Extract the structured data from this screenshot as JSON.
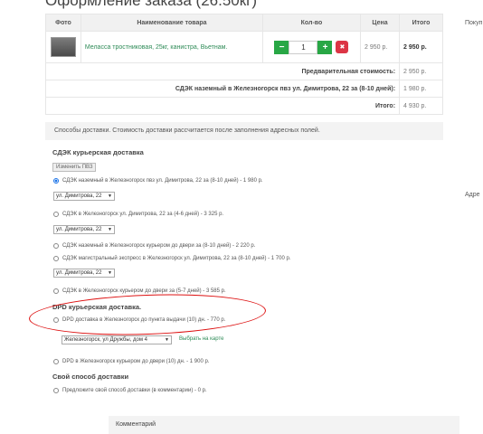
{
  "title": "Оформление заказа (26.50кг)",
  "right": {
    "top_label": "Покуп",
    "mid_label": "Адре"
  },
  "cart": {
    "headers": [
      "Фото",
      "Наименование товара",
      "Кол-во",
      "Цена",
      "Итого"
    ],
    "product": {
      "name": "Меласса тростниковая, 25кг, канистра, Вьетнам.",
      "qty": "1",
      "minus": "−",
      "plus": "+",
      "delete": "✖",
      "price": "2 950 р.",
      "total": "2 950 р."
    },
    "summary": [
      {
        "label": "Предварительная стоимость:",
        "value": "2 950 р."
      },
      {
        "label": "СДЭК наземный в Железногорск пвз ул. Димитрова, 22 за (8-10 дней):",
        "value": "1 980 р."
      },
      {
        "label": "Итого:",
        "value": "4 930 р."
      }
    ]
  },
  "delivery": {
    "notice": "Способы доставки. Стоимость доставки рассчитается после заполнения адресных полей.",
    "cdek_title": "СДЭК курьерская доставка",
    "change_pvz": "Изменить ПВЗ",
    "options": [
      "СДЭК наземный в Железногорск пвз ул. Димитрова, 22 за (8-10 дней) - 1 980 р.",
      "СДЭК в Железногорск ул. Димитрова, 22 за (4-6 дней) - 3 325 р.",
      "СДЭК наземный в Железногорск курьером до двери за (8-10 дней) - 2 220 р.",
      "СДЭК магистральный экспресс в Железногорск ул. Димитрова, 22 за (8-10 дней) - 1 700 р.",
      "СДЭК в Железногорск курьером до двери за (5-7 дней) - 3 585 р."
    ],
    "select_value": "ул. Димитрова, 22",
    "dpd_title": "DPD курьерская доставка.",
    "dpd_options": [
      "DPD доставка в Железногорск до пункта выдачи (10) дн. - 770 р.",
      "DPD в Железногорск курьером до двери (10) дн. - 1 900 р."
    ],
    "dpd_select": "Железногорск, ул Дружбы, дом 4",
    "map_link": "Выбрать на карте",
    "own_title": "Свой способ доставки",
    "own_option": "Предложите свой способ доставки (в комментарии) - 0 р."
  },
  "comment_label": "Комментарий",
  "colors": {
    "accent_green": "#28a745",
    "danger_red": "#dc3545",
    "link_green": "#2e8b57",
    "annotation_red": "#d11111"
  }
}
